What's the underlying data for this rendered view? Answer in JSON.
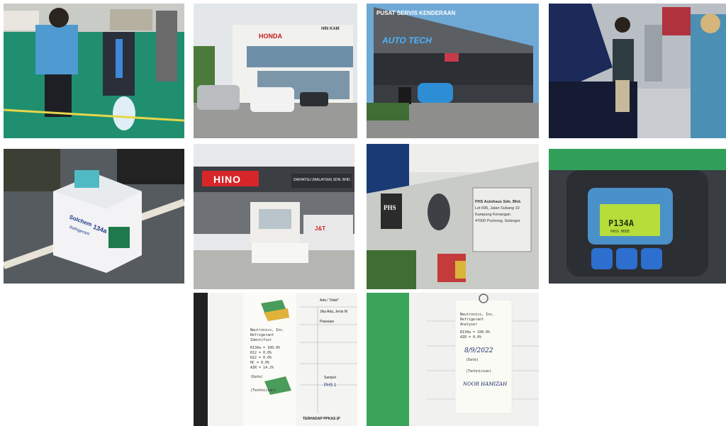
{
  "photos": {
    "p2": {
      "sign": "HONDA",
      "sign2": "HIN KAM"
    },
    "p3": {
      "sign": "PUSAT SERVIS KENDERAAN",
      "logo": "AUTO TECH"
    },
    "p5": {
      "brand": "Solchem",
      "product": "134a",
      "sub": "Refrigerant"
    },
    "p6": {
      "brand": "HINO",
      "sign": "DAIHATSU (MALAYSIA) SDN. BHD.",
      "truck": "J&T"
    },
    "p7": {
      "logo": "PHS",
      "plaque_line1": "PHS Autohaus Sdn. Bhd.",
      "plaque_line2": "Lot 695, Jalan Subang 10",
      "plaque_line3": "Kampung Kenangan",
      "plaque_line4": "47000 Puchong, Selangor"
    },
    "p8": {
      "screen_label": "P134A",
      "screen_sub": "PASS MODE"
    },
    "p9": {
      "title1": "Neutronics, Inc.",
      "title2": "Refrigerant",
      "title3": "Identifier",
      "rows": [
        "R134a = 100.0%",
        "R12   =   0.0%",
        "R22   =   0.0%",
        "HC    =   0.0%",
        "AIR   =  14.2%"
      ],
      "date": "(Date)",
      "tech": "(Technician)",
      "form_h1": "Ada / Tidak*",
      "form_h2": "Jika Ada, Jenis M",
      "form_h3": "Piawaian",
      "form_h4": "Sampel",
      "form_h5": "PHS 1",
      "form_footer": "TERHADAP PPKAS (P"
    },
    "p10": {
      "title1": "Neutronics, Inc.",
      "title2": "Refrigerant",
      "title3": "Analyser",
      "rows": [
        "R134a = 100.0%",
        "AIR = 0.0%"
      ],
      "date_val": "8/9/2022",
      "date": "(Date)",
      "tech": "(Technician)",
      "name": "NOOR HAMIZAH"
    }
  }
}
